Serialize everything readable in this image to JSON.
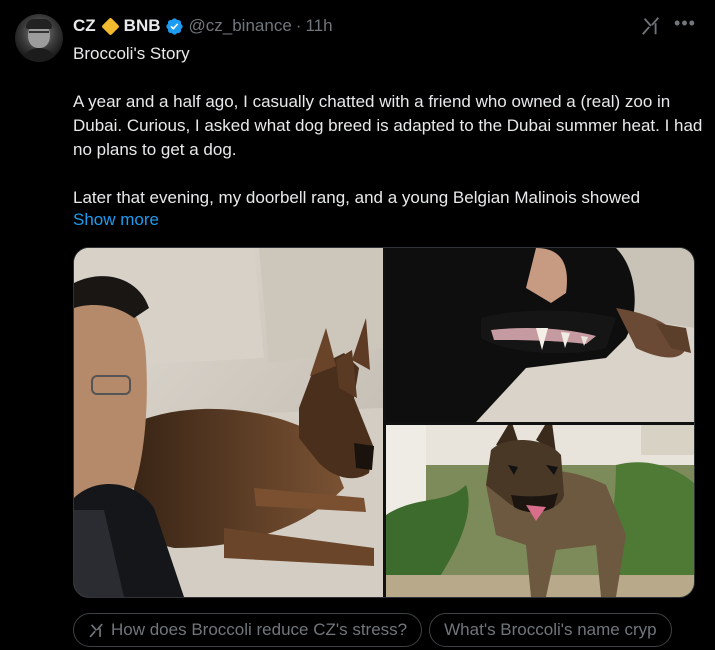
{
  "author": {
    "name": "CZ",
    "name_suffix": "BNB",
    "handle": "@cz_binance",
    "separator": "·",
    "time": "11h",
    "verified": true,
    "badge_color": "#f3ba2f",
    "verified_color": "#1d9bf0"
  },
  "post": {
    "title": "Broccoli's Story",
    "paragraph1": "A year and a half ago, I casually chatted with a friend who owned a (real) zoo in Dubai. Curious, I asked what dog breed is adapted to the Dubai summer heat. I had no plans to get a dog.",
    "paragraph2": "Later that evening, my doorbell rang, and a young Belgian Malinois showed",
    "show_more": "Show more"
  },
  "media": {
    "images": [
      {
        "name": "selfie-with-dog-photo"
      },
      {
        "name": "dog-teeth-closeup-photo"
      },
      {
        "name": "dog-in-garden-photo"
      }
    ]
  },
  "suggestions": [
    {
      "label": "How does Broccoli reduce CZ's stress?",
      "icon": "grok-icon"
    },
    {
      "label": "What's Broccoli's name cryp",
      "icon": ""
    }
  ],
  "icons": {
    "grok": "grok-icon",
    "more": "more-icon"
  },
  "colors": {
    "background": "#000000",
    "text": "#e7e9ea",
    "muted": "#71767b",
    "link": "#1d9bf0",
    "border": "#2f3336"
  }
}
